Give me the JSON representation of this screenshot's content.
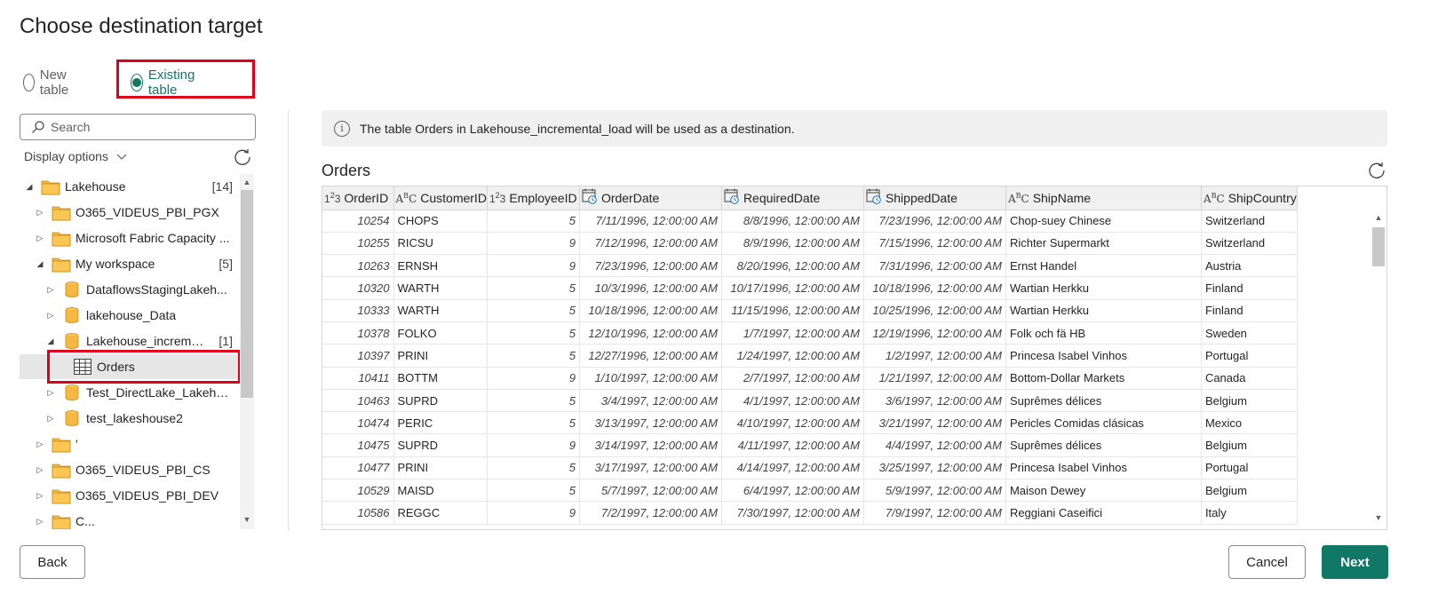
{
  "dialog": {
    "title": "Choose destination target"
  },
  "mode": {
    "options": [
      {
        "label": "New table",
        "checked": false
      },
      {
        "label": "Existing table",
        "checked": true
      }
    ]
  },
  "navigator": {
    "search_placeholder": "Search",
    "display_options_label": "Display options",
    "tree": [
      {
        "label": "Lakehouse",
        "count": "[14]",
        "level": 0,
        "expanded": true,
        "icon": "folder-icon"
      },
      {
        "label": "O365_VIDEUS_PBI_PGX",
        "count": "",
        "level": 1,
        "expanded": false,
        "icon": "folder-icon"
      },
      {
        "label": "Microsoft Fabric Capacity ...",
        "count": "",
        "level": 1,
        "expanded": false,
        "icon": "folder-icon"
      },
      {
        "label": "My workspace",
        "count": "[5]",
        "level": 1,
        "expanded": true,
        "icon": "folder-icon"
      },
      {
        "label": "DataflowsStagingLakeh...",
        "count": "",
        "level": 2,
        "expanded": false,
        "icon": "lakehouse-icon"
      },
      {
        "label": "lakehouse_Data",
        "count": "",
        "level": 2,
        "expanded": false,
        "icon": "lakehouse-icon"
      },
      {
        "label": "Lakehouse_increme...",
        "count": "[1]",
        "level": 2,
        "expanded": true,
        "icon": "lakehouse-icon"
      },
      {
        "label": "Orders",
        "count": "",
        "level": 3,
        "expanded": null,
        "icon": "table-icon",
        "selected": true
      },
      {
        "label": "Test_DirectLake_Lakeho...",
        "count": "",
        "level": 2,
        "expanded": false,
        "icon": "lakehouse-icon"
      },
      {
        "label": "test_lakeshouse2",
        "count": "",
        "level": 2,
        "expanded": false,
        "icon": "lakehouse-icon"
      },
      {
        "label": "'",
        "count": "",
        "level": 1,
        "expanded": false,
        "icon": "folder-icon"
      },
      {
        "label": "O365_VIDEUS_PBI_CS",
        "count": "",
        "level": 1,
        "expanded": false,
        "icon": "folder-icon"
      },
      {
        "label": "O365_VIDEUS_PBI_DEV",
        "count": "",
        "level": 1,
        "expanded": false,
        "icon": "folder-icon"
      },
      {
        "label": "C...",
        "count": "",
        "level": 1,
        "expanded": false,
        "icon": "folder-icon"
      }
    ]
  },
  "info": {
    "message": "The table Orders in Lakehouse_incremental_load will be used as a destination."
  },
  "preview": {
    "title": "Orders",
    "columns": [
      {
        "name": "OrderID",
        "type_icon": "number-type-icon"
      },
      {
        "name": "CustomerID",
        "type_icon": "text-type-icon"
      },
      {
        "name": "EmployeeID",
        "type_icon": "number-type-icon"
      },
      {
        "name": "OrderDate",
        "type_icon": "datetime-type-icon"
      },
      {
        "name": "RequiredDate",
        "type_icon": "datetime-type-icon"
      },
      {
        "name": "ShippedDate",
        "type_icon": "datetime-type-icon"
      },
      {
        "name": "ShipName",
        "type_icon": "text-type-icon"
      },
      {
        "name": "ShipCountry",
        "type_icon": "text-type-icon"
      }
    ],
    "rows": [
      [
        "10254",
        "CHOPS",
        "5",
        "7/11/1996, 12:00:00 AM",
        "8/8/1996, 12:00:00 AM",
        "7/23/1996, 12:00:00 AM",
        "Chop-suey Chinese",
        "Switzerland"
      ],
      [
        "10255",
        "RICSU",
        "9",
        "7/12/1996, 12:00:00 AM",
        "8/9/1996, 12:00:00 AM",
        "7/15/1996, 12:00:00 AM",
        "Richter Supermarkt",
        "Switzerland"
      ],
      [
        "10263",
        "ERNSH",
        "9",
        "7/23/1996, 12:00:00 AM",
        "8/20/1996, 12:00:00 AM",
        "7/31/1996, 12:00:00 AM",
        "Ernst Handel",
        "Austria"
      ],
      [
        "10320",
        "WARTH",
        "5",
        "10/3/1996, 12:00:00 AM",
        "10/17/1996, 12:00:00 AM",
        "10/18/1996, 12:00:00 AM",
        "Wartian Herkku",
        "Finland"
      ],
      [
        "10333",
        "WARTH",
        "5",
        "10/18/1996, 12:00:00 AM",
        "11/15/1996, 12:00:00 AM",
        "10/25/1996, 12:00:00 AM",
        "Wartian Herkku",
        "Finland"
      ],
      [
        "10378",
        "FOLKO",
        "5",
        "12/10/1996, 12:00:00 AM",
        "1/7/1997, 12:00:00 AM",
        "12/19/1996, 12:00:00 AM",
        "Folk och fä HB",
        "Sweden"
      ],
      [
        "10397",
        "PRINI",
        "5",
        "12/27/1996, 12:00:00 AM",
        "1/24/1997, 12:00:00 AM",
        "1/2/1997, 12:00:00 AM",
        "Princesa Isabel Vinhos",
        "Portugal"
      ],
      [
        "10411",
        "BOTTM",
        "9",
        "1/10/1997, 12:00:00 AM",
        "2/7/1997, 12:00:00 AM",
        "1/21/1997, 12:00:00 AM",
        "Bottom-Dollar Markets",
        "Canada"
      ],
      [
        "10463",
        "SUPRD",
        "5",
        "3/4/1997, 12:00:00 AM",
        "4/1/1997, 12:00:00 AM",
        "3/6/1997, 12:00:00 AM",
        "Suprêmes délices",
        "Belgium"
      ],
      [
        "10474",
        "PERIC",
        "5",
        "3/13/1997, 12:00:00 AM",
        "4/10/1997, 12:00:00 AM",
        "3/21/1997, 12:00:00 AM",
        "Pericles Comidas clásicas",
        "Mexico"
      ],
      [
        "10475",
        "SUPRD",
        "9",
        "3/14/1997, 12:00:00 AM",
        "4/11/1997, 12:00:00 AM",
        "4/4/1997, 12:00:00 AM",
        "Suprêmes délices",
        "Belgium"
      ],
      [
        "10477",
        "PRINI",
        "5",
        "3/17/1997, 12:00:00 AM",
        "4/14/1997, 12:00:00 AM",
        "3/25/1997, 12:00:00 AM",
        "Princesa Isabel Vinhos",
        "Portugal"
      ],
      [
        "10529",
        "MAISD",
        "5",
        "5/7/1997, 12:00:00 AM",
        "6/4/1997, 12:00:00 AM",
        "5/9/1997, 12:00:00 AM",
        "Maison Dewey",
        "Belgium"
      ],
      [
        "10586",
        "REGGC",
        "9",
        "7/2/1997, 12:00:00 AM",
        "7/30/1997, 12:00:00 AM",
        "7/9/1997, 12:00:00 AM",
        "Reggiani Caseifici",
        "Italy"
      ]
    ]
  },
  "footer": {
    "back_label": "Back",
    "cancel_label": "Cancel",
    "next_label": "Next"
  },
  "colors": {
    "accent": "#117865",
    "highlight_box": "#e0001b",
    "folder": "#f5b843"
  }
}
